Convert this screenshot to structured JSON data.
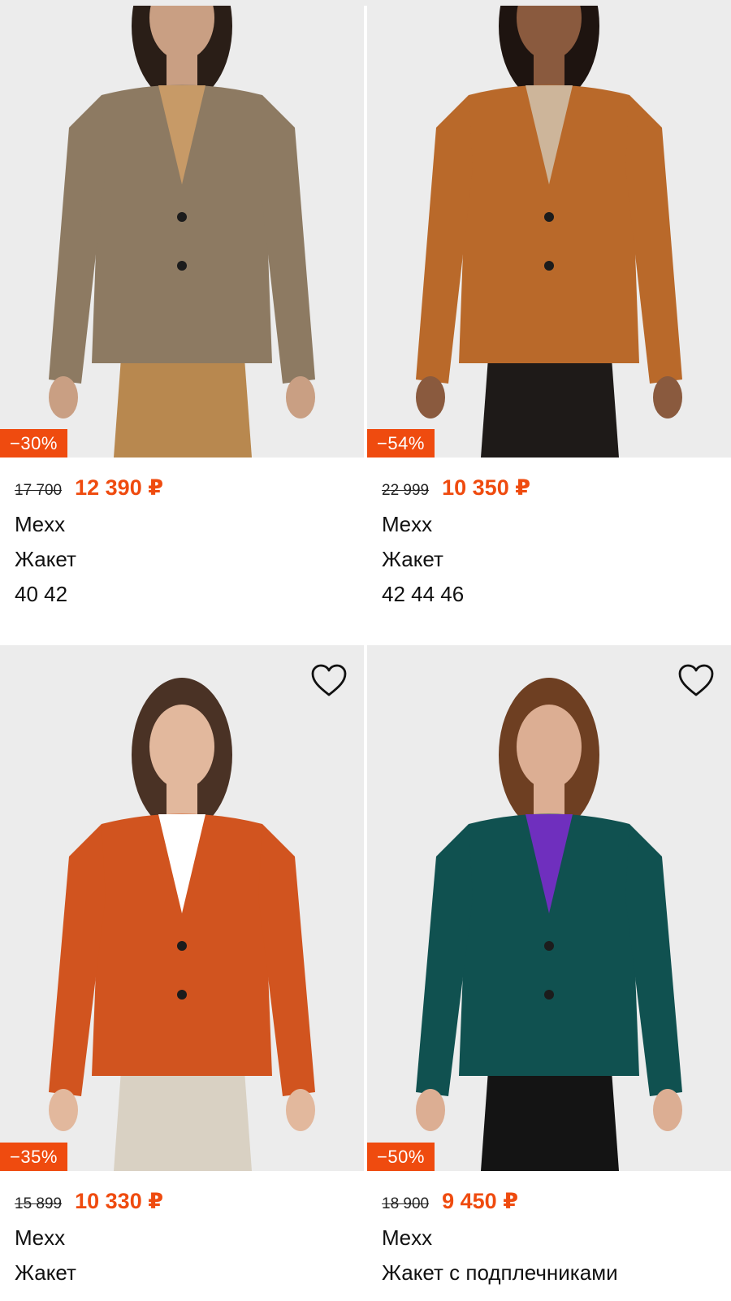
{
  "products": [
    {
      "discount": "−30%",
      "old_price": "17 700",
      "price": "12 390 ₽",
      "brand": "Mexx",
      "title": "Жакет",
      "sizes": "40 42",
      "has_favorite": false,
      "colors": {
        "jacket": "#8d7a62",
        "pants": "#b8884f",
        "skin": "#c99f83",
        "hair": "#2a1e17",
        "inner": "#c79a67"
      }
    },
    {
      "discount": "−54%",
      "old_price": "22 999",
      "price": "10 350 ₽",
      "brand": "Mexx",
      "title": "Жакет",
      "sizes": "42 44 46",
      "has_favorite": false,
      "colors": {
        "jacket": "#b9692a",
        "pants": "#1e1a18",
        "skin": "#8a5a3e",
        "hair": "#1e1410",
        "inner": "#cdb59a"
      }
    },
    {
      "discount": "−35%",
      "old_price": "15 899",
      "price": "10 330 ₽",
      "brand": "Mexx",
      "title": "Жакет",
      "sizes": "",
      "has_favorite": true,
      "colors": {
        "jacket": "#d1541f",
        "pants": "#d9d1c3",
        "skin": "#e2b89d",
        "hair": "#4a3225",
        "inner": "#ffffff"
      }
    },
    {
      "discount": "−50%",
      "old_price": "18 900",
      "price": "9 450 ₽",
      "brand": "Mexx",
      "title": "Жакет с подплечниками",
      "sizes": "",
      "has_favorite": true,
      "colors": {
        "jacket": "#105150",
        "pants": "#141414",
        "skin": "#dcae93",
        "hair": "#6e3f22",
        "inner": "#6f2fbe"
      }
    }
  ],
  "icons": {
    "favorite": "heart-outline-icon"
  },
  "accent_color": "#ef4b0f"
}
